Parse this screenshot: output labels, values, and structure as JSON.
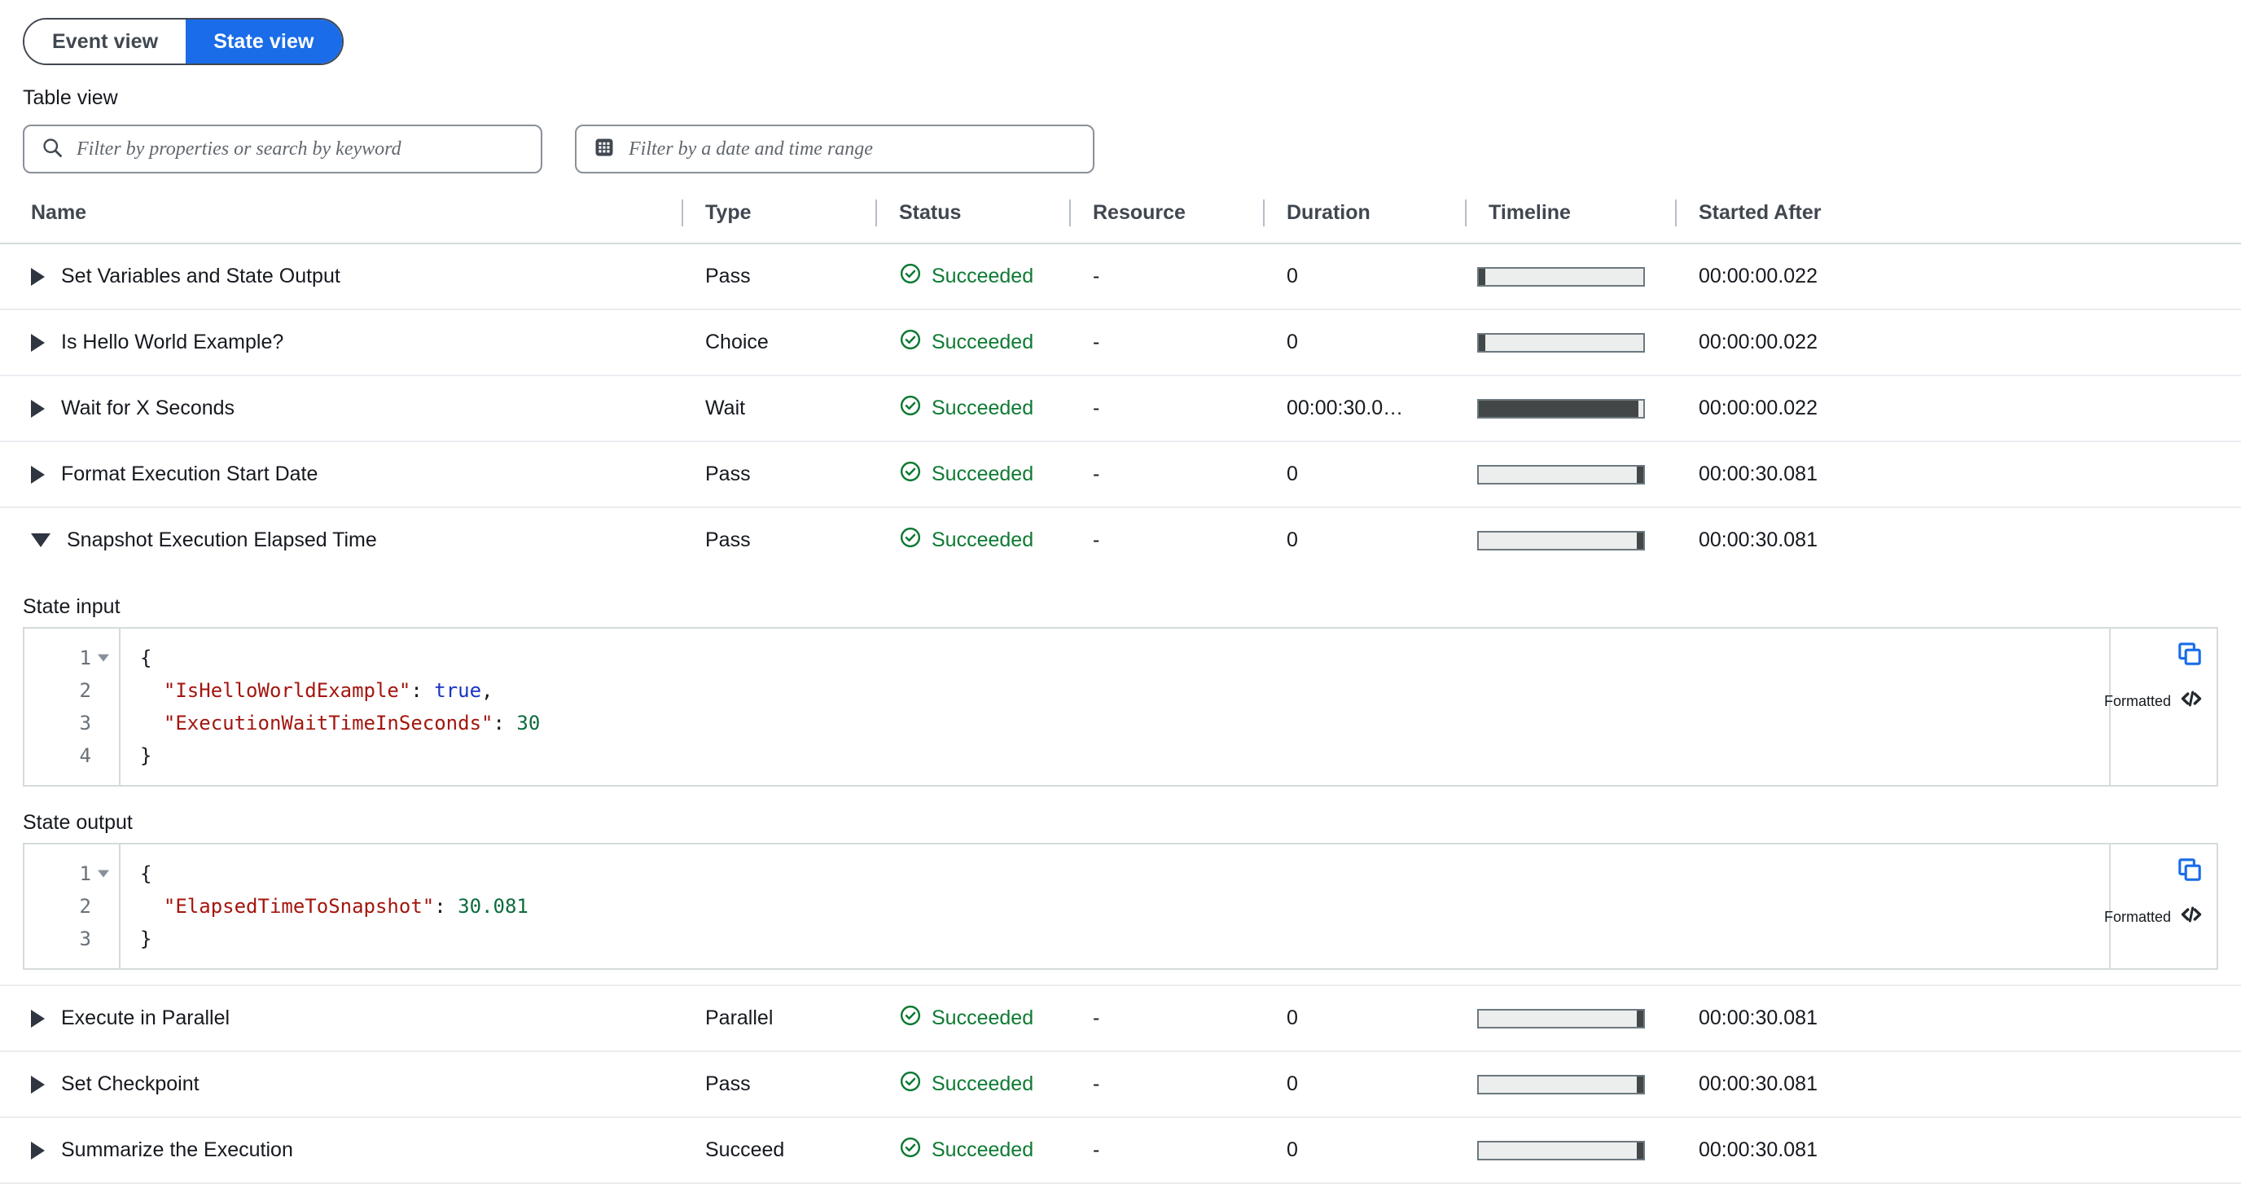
{
  "view_toggle": {
    "options": [
      {
        "label": "Event view",
        "active": false
      },
      {
        "label": "State view",
        "active": true
      }
    ]
  },
  "table_view_label": "Table view",
  "filters": {
    "search_placeholder": "Filter by properties or search by keyword",
    "date_placeholder": "Filter by a date and time range"
  },
  "table": {
    "columns": [
      "Name",
      "Type",
      "Status",
      "Resource",
      "Duration",
      "Timeline",
      "Started After"
    ],
    "rows": [
      {
        "name": "Set Variables and State Output",
        "type": "Pass",
        "status": "Succeeded",
        "resource": "-",
        "duration": "0",
        "started_after": "00:00:00.022",
        "timeline": {
          "offset_pct": 0,
          "width_pct": 4
        },
        "expanded": false
      },
      {
        "name": "Is Hello World Example?",
        "type": "Choice",
        "status": "Succeeded",
        "resource": "-",
        "duration": "0",
        "started_after": "00:00:00.022",
        "timeline": {
          "offset_pct": 0,
          "width_pct": 4
        },
        "expanded": false
      },
      {
        "name": "Wait for X Seconds",
        "type": "Wait",
        "status": "Succeeded",
        "resource": "-",
        "duration": "00:00:30.0…",
        "started_after": "00:00:00.022",
        "timeline": {
          "offset_pct": 0,
          "width_pct": 97
        },
        "expanded": false
      },
      {
        "name": "Format Execution Start Date",
        "type": "Pass",
        "status": "Succeeded",
        "resource": "-",
        "duration": "0",
        "started_after": "00:00:30.081",
        "timeline": {
          "offset_pct": 96,
          "width_pct": 4
        },
        "expanded": false
      },
      {
        "name": "Snapshot Execution Elapsed Time",
        "type": "Pass",
        "status": "Succeeded",
        "resource": "-",
        "duration": "0",
        "started_after": "00:00:30.081",
        "timeline": {
          "offset_pct": 96,
          "width_pct": 4
        },
        "expanded": true,
        "detail": {
          "input_label": "State input",
          "output_label": "State output",
          "formatted_label": "Formatted",
          "input_lines": [
            {
              "n": "1",
              "fold": true,
              "tokens": [
                {
                  "t": "{",
                  "c": "tok-pun"
                }
              ]
            },
            {
              "n": "2",
              "fold": false,
              "tokens": [
                {
                  "t": "  \"IsHelloWorldExample\"",
                  "c": "tok-key"
                },
                {
                  "t": ": ",
                  "c": "tok-pun"
                },
                {
                  "t": "true",
                  "c": "tok-bool"
                },
                {
                  "t": ",",
                  "c": "tok-pun"
                }
              ]
            },
            {
              "n": "3",
              "fold": false,
              "tokens": [
                {
                  "t": "  \"ExecutionWaitTimeInSeconds\"",
                  "c": "tok-key"
                },
                {
                  "t": ": ",
                  "c": "tok-pun"
                },
                {
                  "t": "30",
                  "c": "tok-num"
                }
              ]
            },
            {
              "n": "4",
              "fold": false,
              "tokens": [
                {
                  "t": "}",
                  "c": "tok-pun"
                }
              ]
            }
          ],
          "output_lines": [
            {
              "n": "1",
              "fold": true,
              "tokens": [
                {
                  "t": "{",
                  "c": "tok-pun"
                }
              ]
            },
            {
              "n": "2",
              "fold": false,
              "tokens": [
                {
                  "t": "  \"ElapsedTimeToSnapshot\"",
                  "c": "tok-key"
                },
                {
                  "t": ": ",
                  "c": "tok-pun"
                },
                {
                  "t": "30.081",
                  "c": "tok-num"
                }
              ]
            },
            {
              "n": "3",
              "fold": false,
              "tokens": [
                {
                  "t": "}",
                  "c": "tok-pun"
                }
              ]
            }
          ]
        }
      },
      {
        "name": "Execute in Parallel",
        "type": "Parallel",
        "status": "Succeeded",
        "resource": "-",
        "duration": "0",
        "started_after": "00:00:30.081",
        "timeline": {
          "offset_pct": 96,
          "width_pct": 4
        },
        "expanded": false
      },
      {
        "name": "Set Checkpoint",
        "type": "Pass",
        "status": "Succeeded",
        "resource": "-",
        "duration": "0",
        "started_after": "00:00:30.081",
        "timeline": {
          "offset_pct": 96,
          "width_pct": 4
        },
        "expanded": false
      },
      {
        "name": "Summarize the Execution",
        "type": "Succeed",
        "status": "Succeeded",
        "resource": "-",
        "duration": "0",
        "started_after": "00:00:30.081",
        "timeline": {
          "offset_pct": 96,
          "width_pct": 4
        },
        "expanded": false
      }
    ]
  },
  "colors": {
    "accent_blue": "#1a6ce8",
    "success_green": "#0e7a33",
    "timeline_fill": "#434748",
    "timeline_track": "#eceded",
    "json_key": "#a3160f",
    "json_bool": "#1933c4",
    "json_num": "#0c6b3d"
  }
}
